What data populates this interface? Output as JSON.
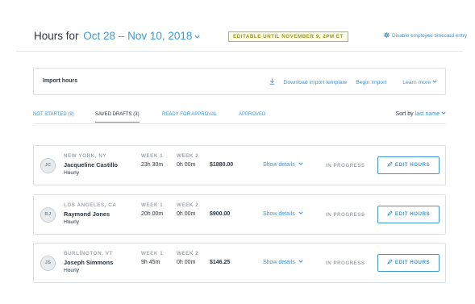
{
  "header": {
    "prefix": "Hours for",
    "date_range": "Oct 28 – Nov 10, 2018",
    "editable_badge": "EDITABLE UNTIL NOVEMBER 9, 2PM ET",
    "disable_link": "Disable employee timecard entry"
  },
  "import": {
    "title": "Import hours",
    "download": "Download import template",
    "begin": "Begin import",
    "learn_more": "Learn more"
  },
  "tabs": [
    {
      "label": "NOT STARTED (9)"
    },
    {
      "label": "SAVED DRAFTS (3)"
    },
    {
      "label": "READY FOR APPROVAL"
    },
    {
      "label": "APPROVED"
    }
  ],
  "sort": {
    "label": "Sort by",
    "value": "last name"
  },
  "column_labels": {
    "week1": "WEEK 1",
    "week2": "WEEK 2"
  },
  "rows": [
    {
      "initials": "JC",
      "location": "NEW YORK, NY",
      "name": "Jacqueline Castillo",
      "type": "Hourly",
      "week1": "23h 30m",
      "week2": "0h 00m",
      "amount": "$1880.00",
      "details": "Show details",
      "status": "IN PROGRESS",
      "action": "EDIT HOURS"
    },
    {
      "initials": "RJ",
      "location": "LOS ANGELES, CA",
      "name": "Raymond Jones",
      "type": "Hourly",
      "week1": "20h 00m",
      "week2": "0h 00m",
      "amount": "$900.00",
      "details": "Show details",
      "status": "IN PROGRESS",
      "action": "EDIT HOURS"
    },
    {
      "initials": "JS",
      "location": "BURLINGTON, VT",
      "name": "Joseph Simmons",
      "type": "Hourly",
      "week1": "9h 45m",
      "week2": "0h 00m",
      "amount": "$146.25",
      "details": "Show details",
      "status": "IN PROGRESS",
      "action": "EDIT HOURS"
    }
  ],
  "colors": {
    "accent": "#3f95d6",
    "badge": "#b9b839",
    "muted": "#a0a7ae",
    "text": "#2c3640"
  }
}
